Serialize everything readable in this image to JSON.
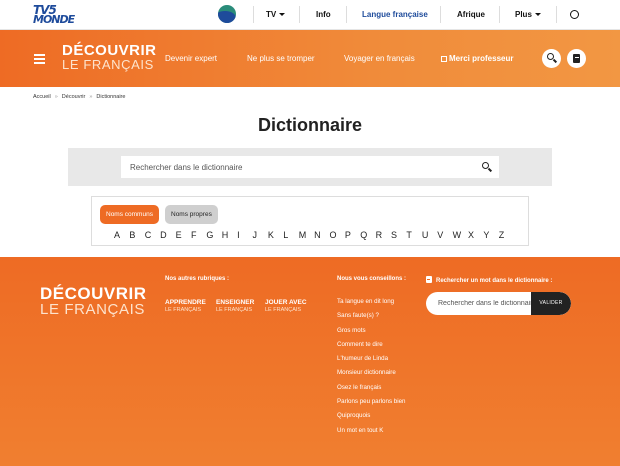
{
  "topbar": {
    "logo_line1": "TV5",
    "logo_line2": "MONDE",
    "nav": [
      {
        "label": "TV",
        "has_caret": true,
        "active": false
      },
      {
        "label": "Info",
        "has_caret": false,
        "active": false
      },
      {
        "label": "Langue française",
        "has_caret": false,
        "active": true
      },
      {
        "label": "Afrique",
        "has_caret": false,
        "active": false
      },
      {
        "label": "Plus",
        "has_caret": true,
        "active": false
      }
    ],
    "icons": [
      "tv5-channel-icon",
      "globe-icon"
    ]
  },
  "header": {
    "brand_line1": "DÉCOUVRIR",
    "brand_line2": "LE FRANÇAIS",
    "nav": [
      {
        "label": "Devenir expert"
      },
      {
        "label": "Ne plus se tromper"
      },
      {
        "label": "Voyager en français"
      },
      {
        "label": "Merci professeur",
        "external": true
      }
    ],
    "icons": [
      "search-icon",
      "book-icon"
    ],
    "color": "#ee6b24"
  },
  "breadcrumb": [
    "Accueil",
    "Découvrir",
    "Dictionnaire"
  ],
  "page_title": "Dictionnaire",
  "search": {
    "placeholder": "Rechercher dans le dictionnaire"
  },
  "letters_panel": {
    "tabs": [
      {
        "label": "Noms communs",
        "active": true
      },
      {
        "label": "Noms propres",
        "active": false
      }
    ],
    "letters": [
      "A",
      "B",
      "C",
      "D",
      "E",
      "F",
      "G",
      "H",
      "I",
      "J",
      "K",
      "L",
      "M",
      "N",
      "O",
      "P",
      "Q",
      "R",
      "S",
      "T",
      "U",
      "V",
      "W",
      "X",
      "Y",
      "Z"
    ]
  },
  "footer": {
    "brand_line1": "DÉCOUVRIR",
    "brand_line2": "LE FRANÇAIS",
    "rubriques_heading": "Nos autres rubriques :",
    "rubriques": [
      {
        "title": "APPRENDRE",
        "sub": "LE FRANÇAIS"
      },
      {
        "title": "ENSEIGNER",
        "sub": "LE FRANÇAIS"
      },
      {
        "title": "JOUER AVEC",
        "sub": "LE FRANÇAIS"
      }
    ],
    "advice_heading": "Nous vous conseillons :",
    "advice": [
      "Ta langue en dit long",
      "Sans faute(s) ?",
      "Gros mots",
      "Comment te dire",
      "L'humeur de Linda",
      "Monsieur dictionnaire",
      "Osez le français",
      "Parlons peu parlons bien",
      "Quiproquois",
      "Un mot en tout K"
    ],
    "dict_heading": "Rechercher un mot dans le dictionnaire :",
    "dict_placeholder": "Rechercher dans le dictionnaire",
    "dict_button": "VALIDER"
  }
}
